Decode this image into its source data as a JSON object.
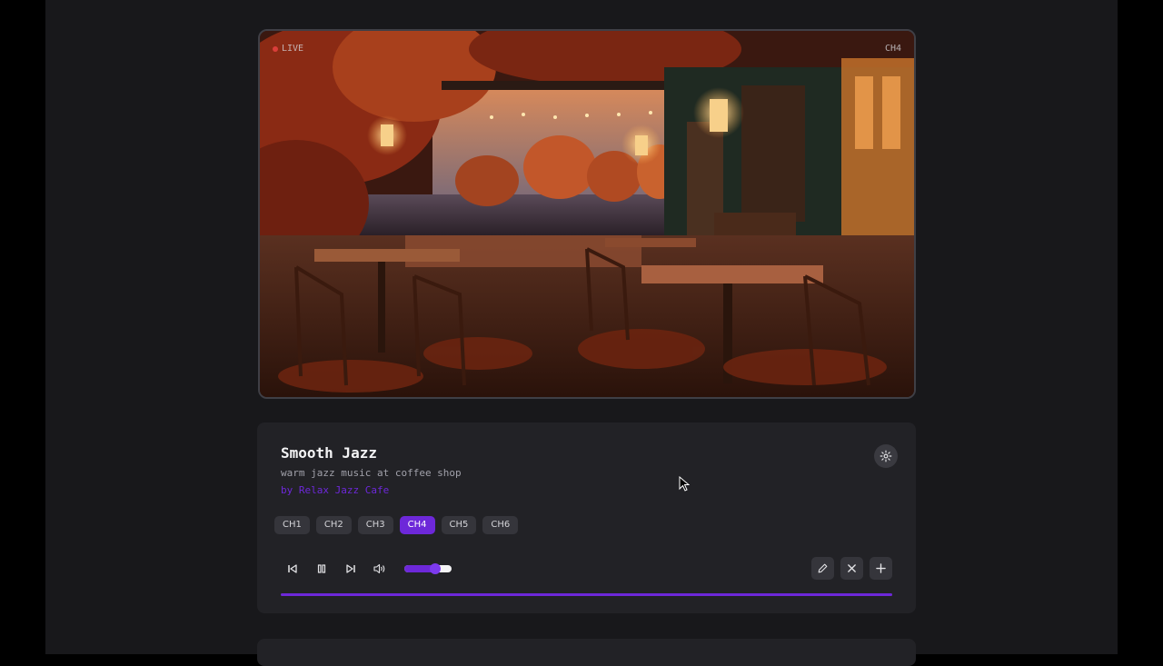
{
  "video": {
    "live_label": "LIVE",
    "channel_label": "CH4"
  },
  "station": {
    "title": "Smooth Jazz",
    "subtitle": "warm jazz music at coffee shop",
    "author": "by Relax Jazz Cafe"
  },
  "channels": [
    {
      "label": "CH1",
      "active": false
    },
    {
      "label": "CH2",
      "active": false
    },
    {
      "label": "CH3",
      "active": false
    },
    {
      "label": "CH4",
      "active": true
    },
    {
      "label": "CH5",
      "active": false
    },
    {
      "label": "CH6",
      "active": false
    }
  ],
  "player": {
    "volume": 0.65,
    "progress": 1.0,
    "state": "playing"
  },
  "icons": {
    "settings": "gear-icon",
    "prev": "skip-back-icon",
    "pause": "pause-icon",
    "next": "skip-forward-icon",
    "volume": "volume-icon",
    "edit": "pencil-icon",
    "remove": "close-icon",
    "add": "plus-icon"
  },
  "colors": {
    "accent": "#6d28d9",
    "background": "#18181b",
    "panel": "#222226"
  }
}
